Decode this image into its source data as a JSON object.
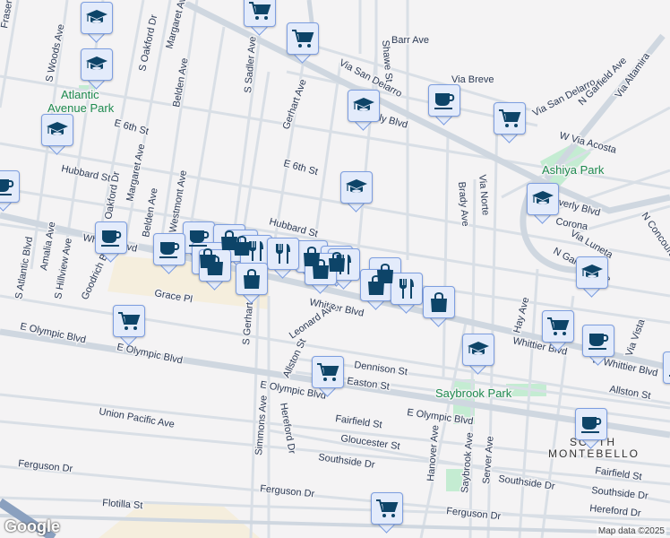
{
  "map": {
    "attribution": "Map data ©2025",
    "logo": "Google",
    "colors": {
      "background": "#f4f3f4",
      "road": "#d5dce4",
      "park": "#c4ecd2",
      "marker_fill": "#e3ebfb",
      "marker_icon": "#0d4468"
    },
    "labels": [
      "Fraser",
      "S Woods Ave",
      "Atlantic",
      "Avenue Park",
      "E 6th St",
      "Hubbard St",
      "Oakford Dr",
      "S Oakford Dr",
      "Margaret Ave",
      "Margaret Ave",
      "Belden Ave",
      "Belden Ave",
      "Westmont Ave",
      "Gerhart Ave",
      "S Sadler Ave",
      "E 6th St",
      "Hubbard St",
      "Whittier Blvd",
      "Whittier Blvd",
      "Barr Ave",
      "Via San Delarro",
      "Via Breve",
      "Via San Delarro",
      "N Garfield Ave",
      "Via Altamira",
      "W Via Acosta",
      "Ashiya Park",
      "Beverly Blvd",
      "Corona",
      "Via Luneta",
      "N Garfield Ave",
      "Brady Ave",
      "Via Norte",
      "Hay Ave",
      "Whittier Blvd",
      "W Whittier Blvd",
      "Via Vista",
      "Allston St",
      "Dennison St",
      "Easton St",
      "Saybrook Park",
      "E Olympic Blvd",
      "E Olympic Blvd",
      "E Olympic Blvd",
      "E Olympic Blvd",
      "Fairfield St",
      "Fairfield St",
      "Gloucester St",
      "Southside Dr",
      "Southside Dr",
      "Southside Dr",
      "Hanover Ave",
      "Saybrook Ave",
      "Server Ave",
      "SOUTH",
      "MONTEBELLO",
      "Hereford Dr",
      "Ferguson Dr",
      "Ferguson Dr",
      "Ferguson Dr",
      "Flotilla St",
      "Union Pacific Ave",
      "Grace Pl",
      "S Gerhart Ave",
      "Simmons Ave",
      "Hereford Dr",
      "Allston St",
      "Leonard Ave",
      "S Atlantic Blvd",
      "Amalia Ave",
      "S Hillview Ave",
      "Goodrich Blvd",
      "Beverly Blvd",
      "Shawe St",
      "N Concourse Ave"
    ],
    "marker_types": {
      "school": "school-icon",
      "shopping": "shopping-cart-icon",
      "cafe": "coffee-cup-icon",
      "store": "shopping-bag-icon",
      "restaurant": "fork-knife-icon"
    }
  }
}
